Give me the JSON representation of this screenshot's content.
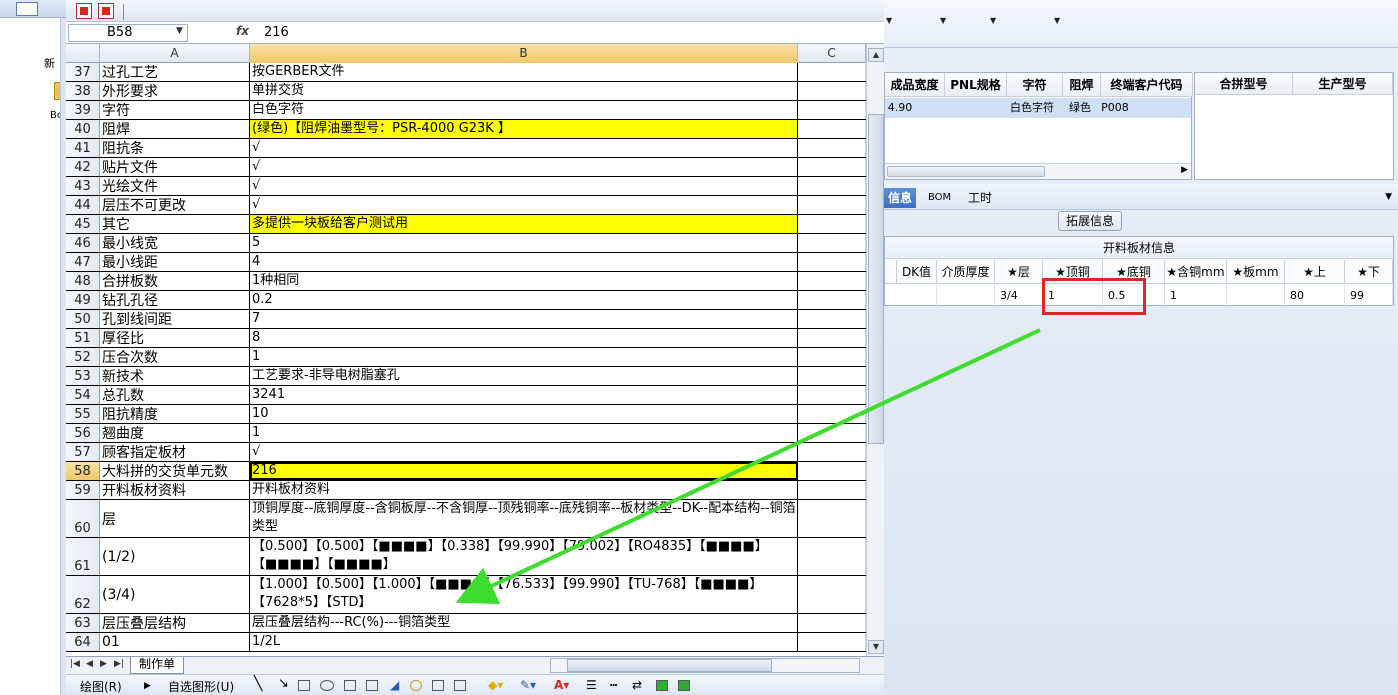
{
  "left_strip": {
    "label1": "新",
    "label2": "Bo"
  },
  "formula_bar": {
    "cell_ref": "B58",
    "fx": "fx",
    "value": "216"
  },
  "columns": [
    "A",
    "B",
    "C"
  ],
  "rows": [
    {
      "n": "37",
      "a": "过孔工艺",
      "b": "按GERBER文件",
      "h": 19
    },
    {
      "n": "38",
      "a": "外形要求",
      "b": "单拼交货",
      "h": 19
    },
    {
      "n": "39",
      "a": "字符",
      "b": "白色字符",
      "h": 19
    },
    {
      "n": "40",
      "a": "阻焊",
      "b": "(绿色)【阻焊油墨型号：PSR-4000 G23K 】",
      "h": 19,
      "yellow": true
    },
    {
      "n": "41",
      "a": "阻抗条",
      "b": "√",
      "h": 19
    },
    {
      "n": "42",
      "a": "贴片文件",
      "b": "√",
      "h": 19
    },
    {
      "n": "43",
      "a": "光绘文件",
      "b": "√",
      "h": 19
    },
    {
      "n": "44",
      "a": "层压不可更改",
      "b": "√",
      "h": 19
    },
    {
      "n": "45",
      "a": "其它",
      "b": "多提供一块板给客户测试用",
      "h": 19,
      "yellow": true
    },
    {
      "n": "46",
      "a": "最小线宽",
      "b": "5",
      "h": 19
    },
    {
      "n": "47",
      "a": "最小线距",
      "b": "4",
      "h": 19
    },
    {
      "n": "48",
      "a": "合拼板数",
      "b": "1种相同",
      "h": 19
    },
    {
      "n": "49",
      "a": "钻孔孔径",
      "b": "0.2",
      "h": 19
    },
    {
      "n": "50",
      "a": "孔到线间距",
      "b": "7",
      "h": 19
    },
    {
      "n": "51",
      "a": "厚径比",
      "b": "8",
      "h": 19
    },
    {
      "n": "52",
      "a": "压合次数",
      "b": "1",
      "h": 19
    },
    {
      "n": "53",
      "a": "新技术",
      "b": "工艺要求-非导电树脂塞孔",
      "h": 19
    },
    {
      "n": "54",
      "a": "总孔数",
      "b": "3241",
      "h": 19
    },
    {
      "n": "55",
      "a": "阻抗精度",
      "b": "10",
      "h": 19
    },
    {
      "n": "56",
      "a": "翘曲度",
      "b": "1",
      "h": 19
    },
    {
      "n": "57",
      "a": "顾客指定板材",
      "b": "√",
      "h": 19
    },
    {
      "n": "58",
      "a": "大料拼的交货单元数",
      "b": "216",
      "h": 19,
      "yellow": true,
      "selected": true
    },
    {
      "n": "59",
      "a": "开料板材资料",
      "b": "开料板材资料",
      "h": 19
    },
    {
      "n": "60",
      "a": "层",
      "b": "顶铜厚度--底铜厚度--含铜板厚--不含铜厚--顶残铜率--底残铜率--板材类型--DK--配本结构--铜箔类型",
      "h": 38
    },
    {
      "n": "61",
      "a": "(1/2)",
      "b": "【0.500】【0.500】【■■■■】【0.338】【99.990】【79.002】【RO4835】【■■■■】【■■■■】【■■■■】",
      "h": 38
    },
    {
      "n": "62",
      "a": "(3/4)",
      "b": "【1.000】【0.500】【1.000】【■■■■】【76.533】【99.990】【TU-768】【■■■■】【7628*5】【STD】",
      "h": 38
    },
    {
      "n": "63",
      "a": "层压叠层结构",
      "b": "层压叠层结构---RC(%)---铜箔类型",
      "h": 19
    },
    {
      "n": "64",
      "a": "01",
      "b": "1/2L",
      "h": 19
    }
  ],
  "sheet_tab": "制作单",
  "draw_toolbar": {
    "draw": "绘图(R)",
    "autoshape": "自选图形(U)"
  },
  "right_panel": {
    "table1_headers": [
      "成品宽度",
      "PNL规格",
      "字符",
      "阻焊",
      "终端客户代码"
    ],
    "table1_row": [
      "4.90",
      "",
      "白色字符",
      "绿色",
      "P008"
    ],
    "table2_headers": [
      "合拼型号",
      "生产型号"
    ],
    "tabs": [
      "信息",
      "BOM",
      "工时"
    ],
    "ext_button": "拓展信息",
    "material_title": "开料板材信息",
    "material_headers": [
      "DK值",
      "介质厚度",
      "★层",
      "★顶铜",
      "★底铜",
      "★含铜mm",
      "★板mm",
      "★上",
      "★下"
    ],
    "material_row": [
      "",
      "",
      "3/4",
      "1",
      "0.5",
      "1",
      "",
      "80",
      "99"
    ]
  },
  "colors": {
    "highlight": "#ffff00",
    "annotation_box": "#e0262b",
    "annotation_arrow": "#3ddc2e",
    "tab_active": "#3b6fbf"
  }
}
